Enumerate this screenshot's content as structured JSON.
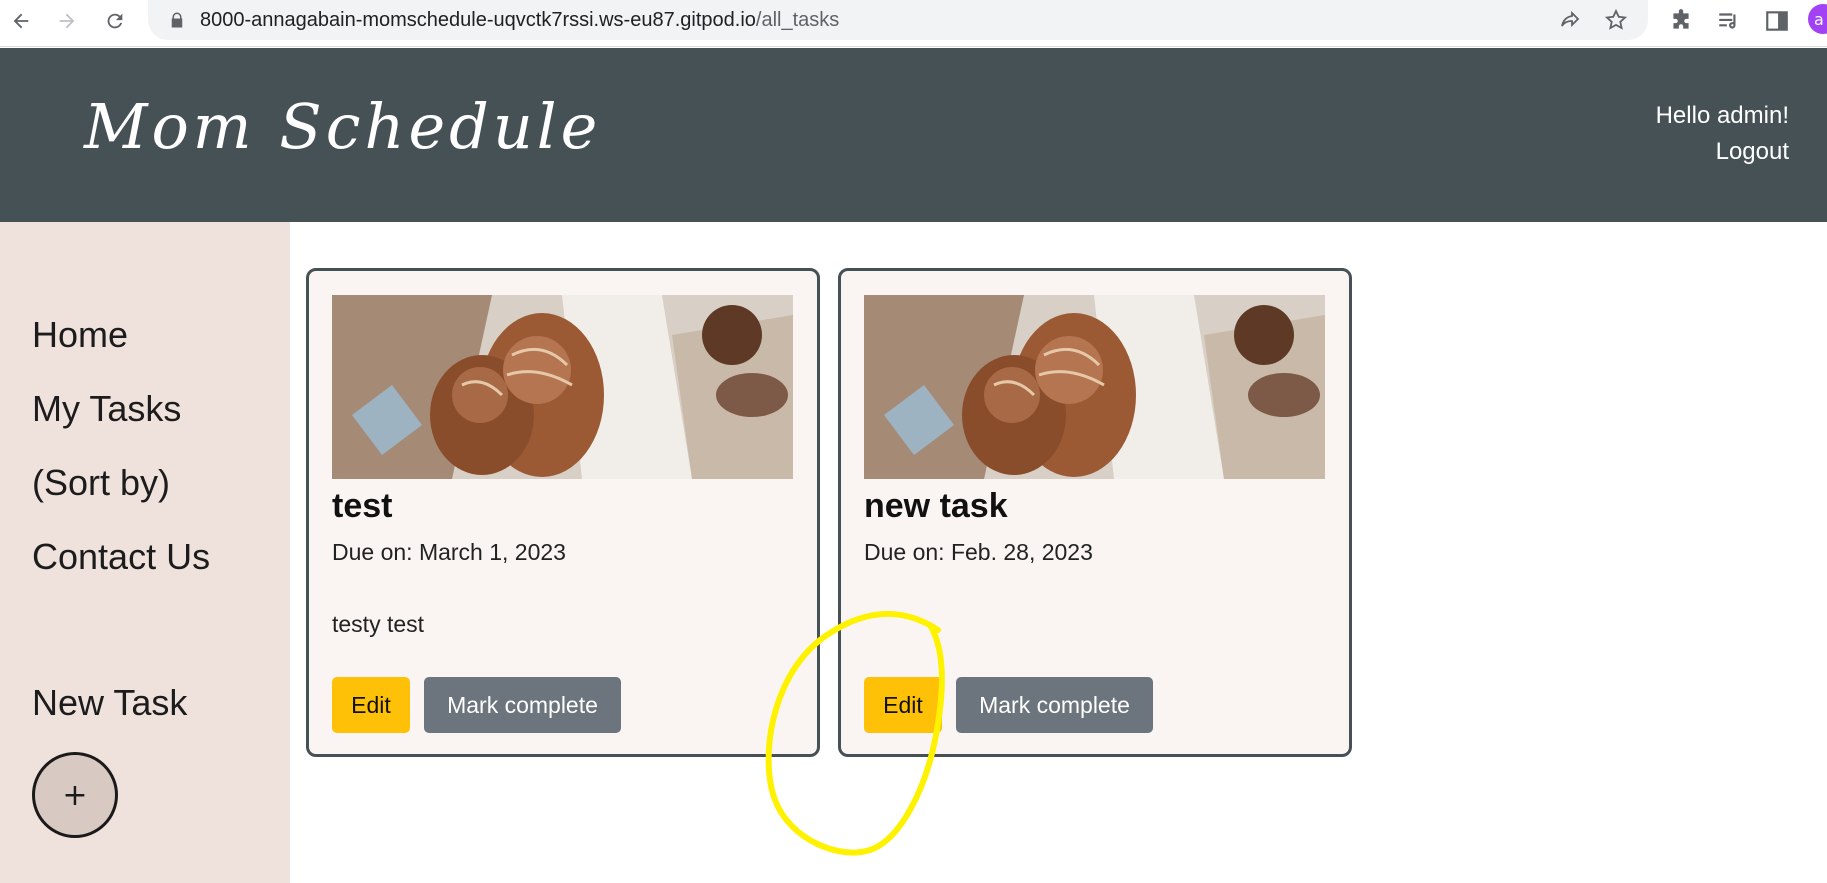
{
  "browser": {
    "url_host": "8000-annagabain-momschedule-uqvctk7rssi.ws-eu87.gitpod.io",
    "url_path": "/all_tasks",
    "profile_initial": "a"
  },
  "header": {
    "brand": "Mom Schedule",
    "greeting": "Hello admin!",
    "logout": "Logout"
  },
  "sidebar": {
    "items": [
      {
        "label": "Home"
      },
      {
        "label": "My Tasks"
      },
      {
        "label": "(Sort by)"
      },
      {
        "label": "Contact Us"
      }
    ],
    "new_task": "New Task",
    "add_symbol": "+"
  },
  "tasks": [
    {
      "title": "test",
      "due": "Due on: March 1, 2023",
      "description": "testy test",
      "edit_label": "Edit",
      "complete_label": "Mark complete"
    },
    {
      "title": "new task",
      "due": "Due on: Feb. 28, 2023",
      "description": "",
      "edit_label": "Edit",
      "complete_label": "Mark complete"
    }
  ],
  "colors": {
    "header_bg": "#465156",
    "sidebar_bg": "#efe2dc",
    "edit_button": "#ffc107",
    "complete_button": "#6c757d",
    "annotation": "#fff200"
  }
}
